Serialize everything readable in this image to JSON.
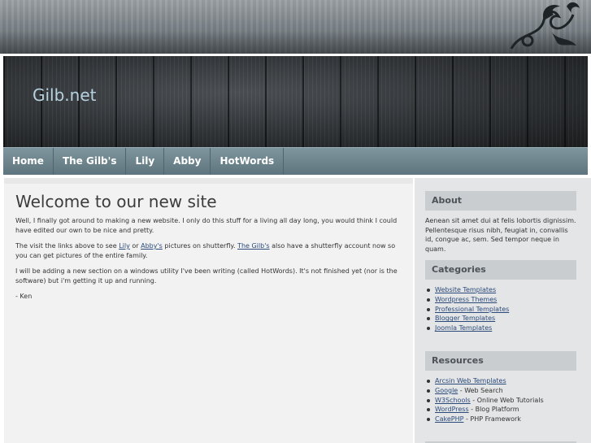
{
  "site": {
    "title": "Gilb.net"
  },
  "nav": {
    "items": [
      "Home",
      "The Gilb's",
      "Lily",
      "Abby",
      "HotWords"
    ]
  },
  "main": {
    "heading": "Welcome to our new site",
    "p1": "Well, I finally got around to making a new website. I only do this stuff for a living all day long, you would think I could have edited our own to be nice and pretty.",
    "p2_a": "The visit the links above to see ",
    "p2_link1": "Lily",
    "p2_b": " or ",
    "p2_link2": "Abby's",
    "p2_c": " pictures on shutterfly. ",
    "p2_link3": "The Gilb's",
    "p2_d": " also have a shutterfly account now so you can get pictures of the entire family.",
    "p3": "I will be adding a new section on a windows utility I've been writing (called HotWords). It's not finished yet (nor is the software) but i'm getting it up and running.",
    "signature": "- Ken"
  },
  "sidebar": {
    "about": {
      "title": "About",
      "text": "Aenean sit amet dui at felis lobortis dignissim. Pellentesque risus nibh, feugiat in, convallis id, congue ac, sem. Sed tempor neque in quam."
    },
    "categories": {
      "title": "Categories",
      "items": [
        "Website Templates",
        "Wordpress Themes",
        "Professional Templates",
        "Blogger Templates",
        "Joomla Templates"
      ]
    },
    "resources": {
      "title": "Resources",
      "items": [
        {
          "link": "Arcsin Web Templates",
          "desc": ""
        },
        {
          "link": "Google",
          "desc": " - Web Search"
        },
        {
          "link": "W3Schools",
          "desc": " - Online Web Tutorials"
        },
        {
          "link": "WordPress",
          "desc": " - Blog Platform"
        },
        {
          "link": "CakePHP",
          "desc": " - PHP Framework"
        }
      ]
    }
  },
  "colors": {
    "nav_bg": "#6d848e",
    "title_text": "#b6d2e0",
    "link": "#2b4a7a",
    "box_head_bg": "#c9cdd0"
  }
}
